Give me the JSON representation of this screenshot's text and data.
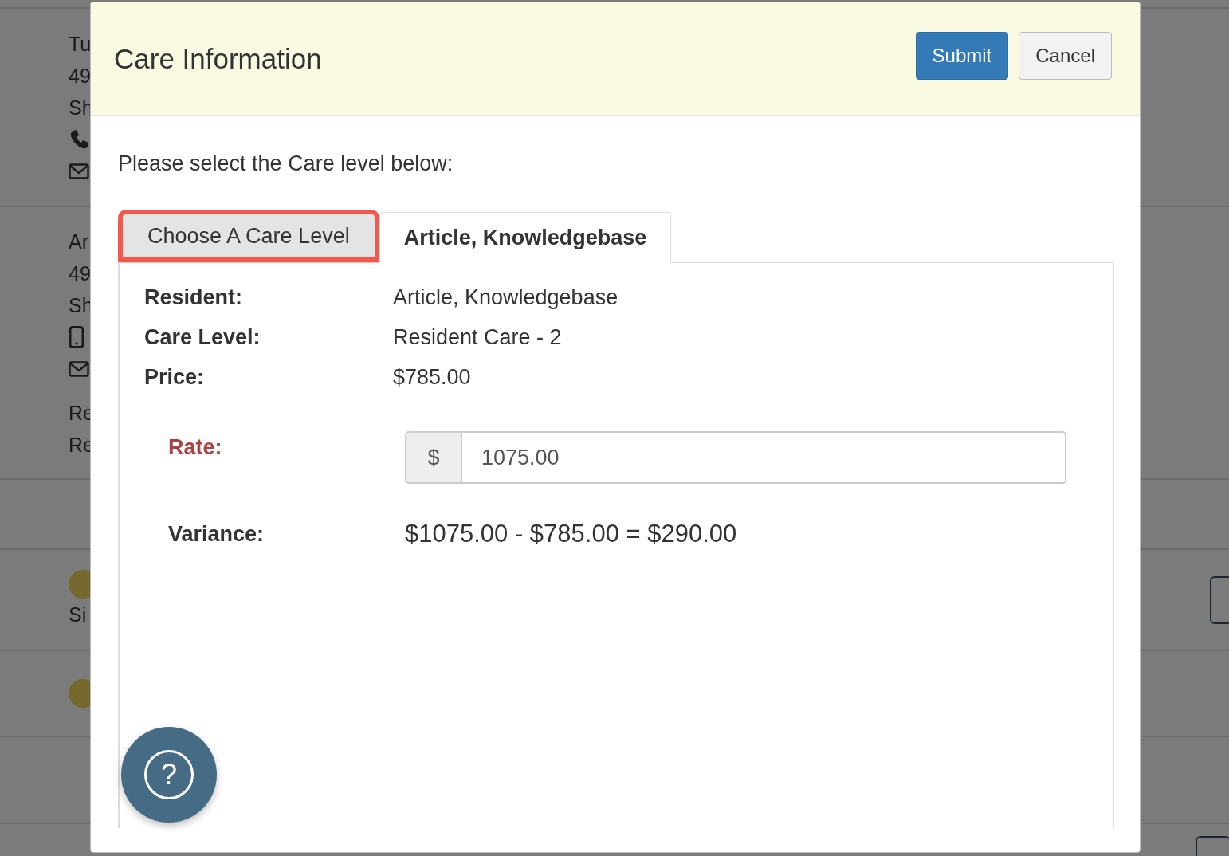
{
  "background": {
    "rows": [
      {
        "kind": "contact",
        "blocks": [
          [
            {
              "kind": "text",
              "text": "Tu"
            },
            {
              "kind": "text",
              "text": "49"
            },
            {
              "kind": "text",
              "text": "Sh"
            },
            {
              "kind": "phone"
            },
            {
              "kind": "mail"
            }
          ]
        ]
      },
      {
        "kind": "contact",
        "blocks": [
          [
            {
              "kind": "text",
              "text": "Ar"
            },
            {
              "kind": "text",
              "text": "49"
            },
            {
              "kind": "text",
              "text": "Sh"
            },
            {
              "kind": "mobile"
            },
            {
              "kind": "mail"
            }
          ],
          [
            {
              "kind": "text",
              "text": "Re"
            },
            {
              "kind": "text",
              "text": "Re"
            }
          ]
        ]
      },
      {
        "kind": "blank"
      },
      {
        "kind": "badge",
        "lines": [
          "Si"
        ],
        "button": true
      },
      {
        "kind": "badge"
      },
      {
        "kind": "blank"
      },
      {
        "kind": "blank",
        "button": true
      }
    ]
  },
  "modal": {
    "title": "Care Information",
    "buttons": [
      {
        "label": "Submit",
        "kind": "primary"
      },
      {
        "label": "Cancel",
        "kind": "default"
      }
    ],
    "prompt": "Please select the Care level below:",
    "tabs": [
      {
        "label": "Choose A Care Level",
        "selected": false,
        "highlighted": true
      },
      {
        "label": "Article, Knowledgebase",
        "selected": true,
        "highlighted": false
      }
    ],
    "details": [
      {
        "label": "Resident:",
        "value": "Article, Knowledgebase"
      },
      {
        "label": "Care Level:",
        "value": "Resident Care - 2"
      },
      {
        "label": "Price:",
        "value": "$785.00"
      }
    ],
    "rate": {
      "label": "Rate:",
      "addon": "$",
      "value": "1075.00"
    },
    "variance": {
      "label": "Variance:",
      "value": "$1075.00 - $785.00 = $290.00"
    }
  },
  "help_button": {
    "label": "?"
  }
}
